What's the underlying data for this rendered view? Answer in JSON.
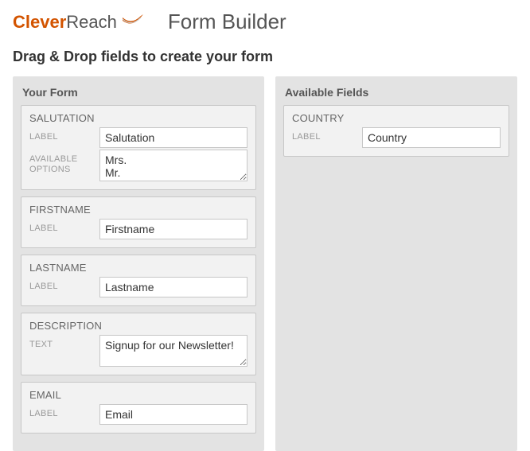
{
  "brand": {
    "clever": "Clever",
    "reach": "Reach"
  },
  "page": {
    "title": "Form Builder",
    "subheading": "Drag & Drop fields to create your form"
  },
  "left_panel": {
    "title": "Your Form",
    "fields": [
      {
        "name": "SALUTATION",
        "label_caption": "LABEL",
        "label_value": "Salutation",
        "options_caption": "AVAILABLE OPTIONS",
        "options_value": "Mrs.\nMr."
      },
      {
        "name": "FIRSTNAME",
        "label_caption": "LABEL",
        "label_value": "Firstname"
      },
      {
        "name": "LASTNAME",
        "label_caption": "LABEL",
        "label_value": "Lastname"
      },
      {
        "name": "DESCRIPTION",
        "text_caption": "TEXT",
        "text_value": "Signup for our Newsletter!"
      },
      {
        "name": "EMAIL",
        "label_caption": "LABEL",
        "label_value": "Email"
      }
    ]
  },
  "right_panel": {
    "title": "Available Fields",
    "fields": [
      {
        "name": "COUNTRY",
        "label_caption": "LABEL",
        "label_value": "Country"
      }
    ]
  }
}
